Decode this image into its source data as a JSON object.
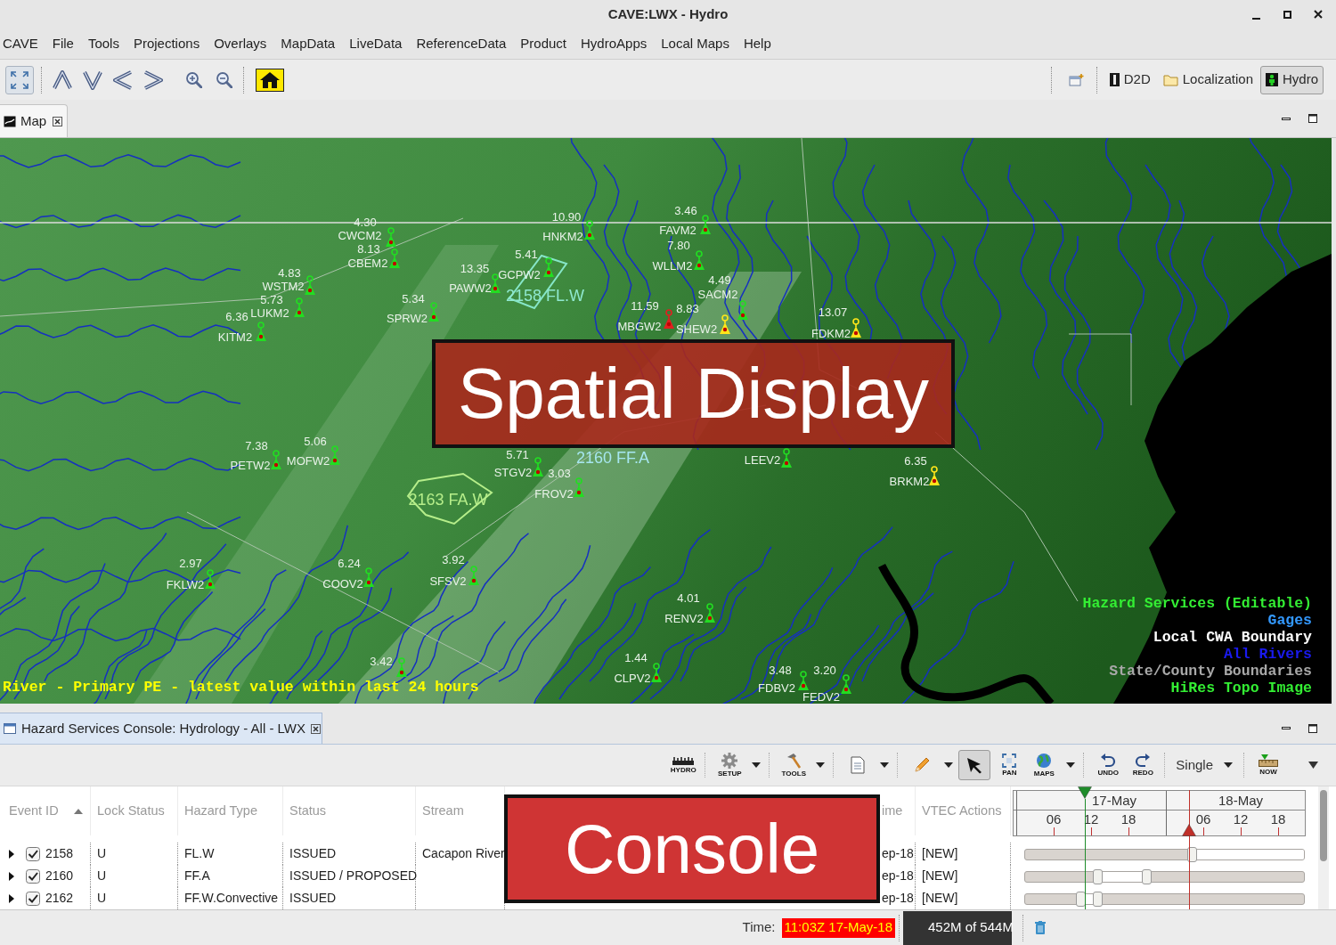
{
  "window": {
    "title": "CAVE:LWX - Hydro"
  },
  "menu": [
    "CAVE",
    "File",
    "Tools",
    "Projections",
    "Overlays",
    "MapData",
    "LiveData",
    "ReferenceData",
    "Product",
    "HydroApps",
    "Local Maps",
    "Help"
  ],
  "perspectives": [
    {
      "label": "D2D",
      "selected": false
    },
    {
      "label": "Localization",
      "selected": false
    },
    {
      "label": "Hydro",
      "selected": true
    }
  ],
  "map_tab": {
    "label": "Map"
  },
  "map": {
    "gauges": [
      {
        "id": "CWCM2",
        "value": "4.30",
        "color": "#22dd22"
      },
      {
        "id": "CBEM2",
        "value": "8.13",
        "color": "#22dd22"
      },
      {
        "id": "HNKM2",
        "value": "10.90",
        "color": "#22dd22"
      },
      {
        "id": "FAVM2",
        "value": "3.46",
        "color": "#22dd22"
      },
      {
        "id": "WLLM2",
        "value": "7.80",
        "color": "#22dd22"
      },
      {
        "id": "GCPW2",
        "value": "5.41",
        "color": "#22dd22"
      },
      {
        "id": "PAWW2",
        "value": "13.35",
        "color": "#22dd22"
      },
      {
        "id": "SPRW2",
        "value": "5.34",
        "color": "#22dd22"
      },
      {
        "id": "WSTM2",
        "value": "4.83",
        "color": "#22dd22"
      },
      {
        "id": "LUKM2",
        "value": "5.73",
        "color": "#22dd22"
      },
      {
        "id": "KITM2",
        "value": "6.36",
        "color": "#22dd22"
      },
      {
        "id": "MBGW2",
        "value": "11.59",
        "color": "#e02020"
      },
      {
        "id": "SHEW2",
        "value": "8.83",
        "color": "#ffe61a"
      },
      {
        "id": "SACM2",
        "value": "4.49",
        "color": "#22dd22"
      },
      {
        "id": "FDKM2",
        "value": "13.07",
        "color": "#ffe61a"
      },
      {
        "id": "PETW2",
        "value": "7.38",
        "color": "#22dd22"
      },
      {
        "id": "MOFW2",
        "value": "5.06",
        "color": "#22dd22"
      },
      {
        "id": "STGV2",
        "value": "5.71",
        "color": "#22dd22"
      },
      {
        "id": "FROV2",
        "value": "3.03",
        "color": "#22dd22"
      },
      {
        "id": "LEEV2",
        "color": "#22dd22"
      },
      {
        "id": "BRKM2",
        "value": "6.35",
        "color": "#ffe61a"
      },
      {
        "id": "FKLW2",
        "value": "2.97",
        "color": "#22dd22"
      },
      {
        "id": "COOV2",
        "value": "6.24",
        "color": "#22dd22"
      },
      {
        "id": "SFSV2",
        "value": "3.92",
        "color": "#22dd22"
      },
      {
        "id": "RENV2",
        "value": "4.01",
        "color": "#22dd22"
      },
      {
        "value": "3.42",
        "color": "#22dd22"
      },
      {
        "id": "CLPV2",
        "value": "1.44",
        "color": "#22dd22"
      },
      {
        "id": "FDBV2",
        "value": "3.48",
        "color": "#22dd22"
      },
      {
        "id": "FEDV2",
        "value": "3.20",
        "color": "#22dd22"
      }
    ],
    "hazard_areas": [
      {
        "label": "2158 FL.W"
      },
      {
        "label": "2160 FF.A"
      },
      {
        "label": "2163 FA.W"
      }
    ],
    "product_legend": "River - Primary PE - latest value within last 24 hours",
    "layers": [
      {
        "label": "Hazard Services (Editable)",
        "color": "#33ee33"
      },
      {
        "label": "Gages",
        "color": "#3399ff"
      },
      {
        "label": "Local CWA Boundary",
        "color": "#ffffff"
      },
      {
        "label": "All Rivers",
        "color": "#1a1aee"
      },
      {
        "label": "State/County Boundaries",
        "color": "#a8a8a8"
      },
      {
        "label": "HiRes Topo Image",
        "color": "#33ee33"
      }
    ]
  },
  "annotations": [
    {
      "label": "Spatial Display"
    },
    {
      "label": "Console"
    }
  ],
  "console_tab": {
    "label": "Hazard Services Console: Hydrology - All - LWX"
  },
  "console_toolbar": {
    "items": [
      {
        "kind": "tool",
        "label": "HYDRO",
        "dropdown": false,
        "selected": false
      },
      {
        "kind": "tool",
        "label": "SETUP",
        "dropdown": true,
        "selected": false
      },
      {
        "kind": "tool",
        "label": "TOOLS",
        "dropdown": true,
        "selected": false
      },
      {
        "kind": "tool",
        "dropdown": true,
        "selected": false
      },
      {
        "kind": "tool",
        "dropdown": true,
        "selected": false
      },
      {
        "kind": "tool",
        "dropdown": false,
        "selected": true
      },
      {
        "kind": "tool",
        "label": "PAN",
        "dropdown": false,
        "selected": false
      },
      {
        "kind": "tool",
        "label": "MAPS",
        "dropdown": true,
        "selected": false
      },
      {
        "kind": "tool",
        "label": "UNDO",
        "dropdown": false,
        "selected": false
      },
      {
        "kind": "tool",
        "label": "REDO",
        "dropdown": false,
        "selected": false
      },
      {
        "kind": "combo",
        "value": "Single"
      },
      {
        "kind": "tool",
        "label": "NOW",
        "dropdown": false,
        "selected": false
      },
      {
        "kind": "menu"
      }
    ]
  },
  "table": {
    "columns": [
      {
        "label": "Event ID",
        "sorted": true
      },
      {
        "label": "Lock Status",
        "sorted": false
      },
      {
        "label": "Hazard Type",
        "sorted": false
      },
      {
        "label": "Status",
        "sorted": false
      },
      {
        "label": "Stream",
        "sorted": false
      },
      {
        "label": "ime",
        "sorted": false
      },
      {
        "label": "VTEC Actions",
        "sorted": false
      }
    ],
    "rows": [
      {
        "expanded": false,
        "checked": true,
        "event_id": "2158",
        "lock_status": "U",
        "hazard_type": "FL.W",
        "status": "ISSUED",
        "stream": "Cacapon River",
        "column_6": "ep-18",
        "vtec_actions": "[NEW]"
      },
      {
        "expanded": false,
        "checked": true,
        "event_id": "2160",
        "lock_status": "U",
        "hazard_type": "FF.A",
        "status": "ISSUED / PROPOSED",
        "column_6": "ep-18",
        "vtec_actions": "[NEW]"
      },
      {
        "expanded": false,
        "checked": true,
        "event_id": "2162",
        "lock_status": "U",
        "hazard_type": "FF.W.Convective",
        "status": "ISSUED",
        "column_6": "ep-18",
        "vtec_actions": "[NEW]"
      }
    ]
  },
  "timeline": {
    "days": [
      {
        "label": "17-May",
        "hours": [
          "06",
          "12",
          "18"
        ]
      },
      {
        "label": "18-May",
        "hours": [
          "06",
          "12",
          "18"
        ]
      }
    ],
    "markers": [
      {
        "kind": "down",
        "color": "#1e8c2a",
        "level": 0.216
      },
      {
        "kind": "up",
        "color": "#c0302a",
        "level": 0.587
      }
    ],
    "rows": [
      {
        "start": {
          "level": 0.597
        }
      },
      {
        "start": {
          "level": 0.263
        },
        "end": {
          "level": 0.435
        }
      },
      {
        "start": {
          "level": 0.2
        },
        "end": {
          "level": 0.263
        }
      }
    ]
  },
  "status_bar": {
    "time_label": "Time:",
    "time": "11:03Z 17-May-18",
    "memory": "452M of 544M"
  }
}
